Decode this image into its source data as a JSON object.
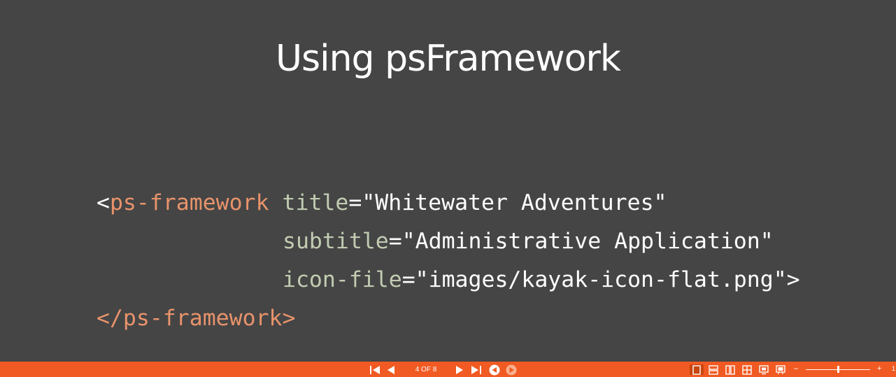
{
  "slide": {
    "title": "Using psFramework",
    "code": {
      "line1": {
        "open": "<",
        "tag": "ps-framework",
        "attr": "title",
        "eq": "=",
        "value": "\"Whitewater Adventures\""
      },
      "line2": {
        "attr": "subtitle",
        "eq": "=",
        "value": "\"Administrative Application\""
      },
      "line3": {
        "attr": "icon-file",
        "eq": "=",
        "value": "\"images/kayak-icon-flat.png\"",
        "close": ">"
      },
      "line4": {
        "tag": "</ps-framework>"
      }
    }
  },
  "toolbar": {
    "page_counter": "4 OF 8",
    "zoom_minus": "–",
    "zoom_plus": "+",
    "zoom_value": "1"
  },
  "colors": {
    "background": "#454545",
    "toolbar": "#f15a22",
    "tag": "#e8936b",
    "attribute": "#c1ccb1",
    "text": "#ffffff"
  },
  "icons": [
    "first-slide-icon",
    "previous-slide-icon",
    "next-slide-icon",
    "last-slide-icon",
    "back-circle-icon",
    "play-circle-icon",
    "single-page-view-icon",
    "stacked-view-icon",
    "two-column-view-icon",
    "grid-view-icon",
    "presenter-view-icon",
    "slideshow-view-icon"
  ]
}
